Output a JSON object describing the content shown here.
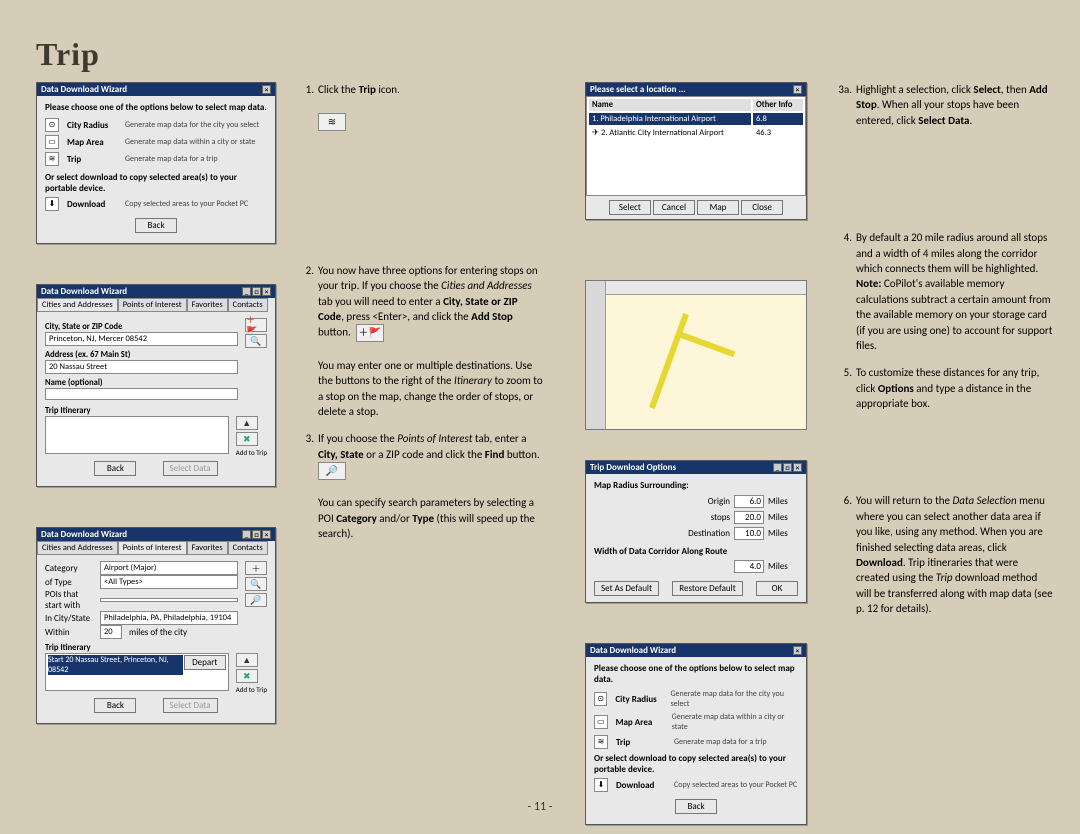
{
  "page": {
    "title": "Trip",
    "page_number": "- 11 -"
  },
  "wizard": {
    "title": "Data Download Wizard",
    "intro": "Please choose one of the options below to select map data.",
    "options": [
      {
        "icon": "⊙",
        "label": "City Radius",
        "desc": "Generate map data for the city you select"
      },
      {
        "icon": "▭",
        "label": "Map Area",
        "desc": "Generate map data within a city or state"
      },
      {
        "icon": "≋",
        "label": "Trip",
        "desc": "Generate map data for a trip"
      }
    ],
    "orline": "Or select download to copy selected area(s) to your portable device.",
    "download": {
      "icon": "⬇",
      "label": "Download",
      "desc": "Copy selected areas to your Pocket PC"
    },
    "back": "Back",
    "select_data": "Select Data"
  },
  "cities": {
    "tabs": [
      "Cities and Addresses",
      "Points of Interest",
      "Favorites",
      "Contacts"
    ],
    "city_label": "City, State or ZIP Code",
    "city_val": "Princeton, NJ, Mercer 08542",
    "addr_label": "Address (ex. 67 Main St)",
    "addr_val": "20 Nassau Street",
    "name_label": "Name (optional)",
    "name_val": "",
    "itin_label": "Trip Itinerary",
    "add_to_trip": "Add to Trip"
  },
  "poi": {
    "cat_label": "Category",
    "cat_val": "Airport (Major)",
    "type_label": "of Type",
    "type_val": "<All Types>",
    "start_label": "POIs that start with",
    "in_label": "In City/State",
    "in_val": "Philadelphia, PA, Philadelphia, 19104",
    "within_label": "Within",
    "within_val": "20",
    "within_suffix": "miles of the city",
    "itin_start": "Start 20 Nassau Street, Princeton, NJ, 08542",
    "depart": "Depart"
  },
  "location": {
    "title": "Please select a location ...",
    "headers": [
      "Name",
      "Other Info"
    ],
    "rows": [
      {
        "name": "1. Philadelphia International Airport",
        "info": "6.8"
      },
      {
        "name": "2. Atlantic City International Airport",
        "info": "46.3"
      }
    ],
    "buttons": [
      "Select",
      "Cancel",
      "Map",
      "Close"
    ]
  },
  "options": {
    "title": "Trip Download Options",
    "subtitle": "Map Radius Surrounding:",
    "origin": "Origin",
    "origin_val": "6.0",
    "stops": "stops",
    "stops_val": "20.0",
    "dest": "Destination",
    "dest_val": "10.0",
    "corridor": "Width of Data Corridor Along Route",
    "corridor_val": "4.0",
    "miles": "Miles",
    "set_def": "Set As Default",
    "restore": "Restore Default",
    "ok": "OK"
  },
  "steps": {
    "s1": "Click the ",
    "s1b": "Trip",
    "s1c": " icon.",
    "s2a": "You now have three options for entering stops on your trip.  If you choose the ",
    "s2b": "Cities and Addresses",
    "s2c": " tab you will need to enter a ",
    "s2d": "City, State or ZIP Code",
    "s2e": ", press <Enter>, and click the ",
    "s2f": "Add Stop",
    "s2g": " button.",
    "s2p2": "You may enter one or multiple destinations.  Use the buttons to the right of the ",
    "s2p2i": "Itinerary",
    "s2p2b": " to zoom to a stop on the map, change the order of stops, or delete a stop.",
    "s3a": "If you choose the ",
    "s3b": "Points of Interest",
    "s3c": " tab, enter a ",
    "s3d": "City, State",
    "s3e": " or a ZIP code and click the ",
    "s3f": "Find",
    "s3g": " button.",
    "s3p2a": "You can specify search parameters by selecting a POI ",
    "s3p2b": "Category",
    "s3p2c": " and/or ",
    "s3p2d": "Type",
    "s3p2e": " (this will speed up the search).",
    "s3a_a": "Highlight a selection, click ",
    "s3a_b": "Select",
    "s3a_c": ", then ",
    "s3a_d": "Add Stop",
    "s3a_e": ". When all your stops have been entered, click ",
    "s3a_f": "Select Data",
    "s3a_g": ".",
    "s4a": "By default a 20 mile radius around all stops and a width of 4 miles along the corridor which connects them will be highlighted.  ",
    "s4b": "Note:",
    "s4c": "  CoPilot's available memory calculations subtract a certain amount from the available memory on your storage card (if you are using one) to account for support files.",
    "s5a": "To customize these distances for any trip, click ",
    "s5b": "Options",
    "s5c": " and type a distance in the appropriate box.",
    "s6a": "You will return to the ",
    "s6b": "Data Selection",
    "s6c": " menu where you can select another data area if you like, using any method.  When you are finished selecting data areas, click ",
    "s6d": "Download",
    "s6e": ".  Trip itineraries that were created using the ",
    "s6f": "Trip",
    "s6g": " download method will be transferred along with map data (see p. 12 for details)."
  }
}
